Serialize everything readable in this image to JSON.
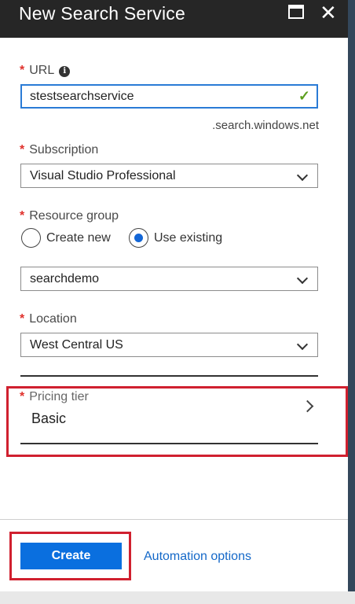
{
  "header": {
    "title": "New Search Service"
  },
  "url": {
    "label": "URL",
    "value": "stestsearchservice",
    "suffix": ".search.windows.net"
  },
  "subscription": {
    "label": "Subscription",
    "value": "Visual Studio Professional"
  },
  "resource_group": {
    "label": "Resource group",
    "option_create_new": "Create new",
    "option_use_existing": "Use existing",
    "selected": "Use existing",
    "value": "searchdemo"
  },
  "location": {
    "label": "Location",
    "value": "West Central US"
  },
  "pricing_tier": {
    "label": "Pricing tier",
    "value": "Basic"
  },
  "footer": {
    "create_label": "Create",
    "automation_label": "Automation options"
  },
  "colors": {
    "accent": "#0a6fdf",
    "highlight": "#d0202f",
    "required": "#e0312c",
    "valid": "#5c9e1e"
  }
}
